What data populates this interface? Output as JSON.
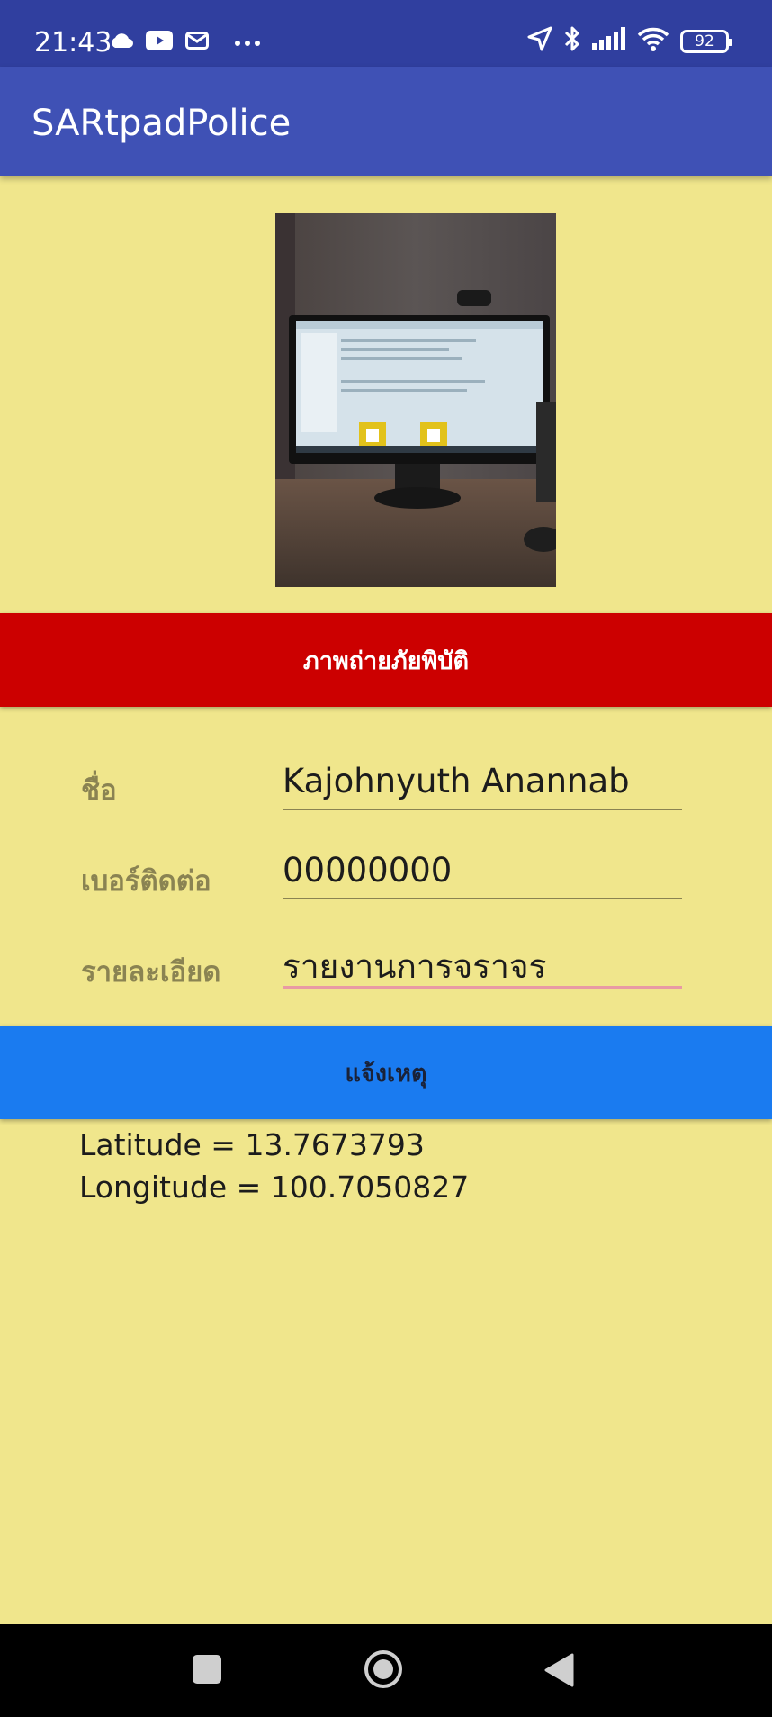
{
  "status_bar": {
    "time": "21:43",
    "left_icons": [
      "cloud-icon",
      "youtube-icon",
      "mail-icon",
      "more-dots-icon"
    ],
    "right_icons": [
      "location-arrow-icon",
      "bluetooth-icon",
      "signal-icon",
      "wifi-icon",
      "battery-icon"
    ],
    "battery_level": "92"
  },
  "app_bar": {
    "title": "SARtpadPolice"
  },
  "photo": {
    "description_icon": "captured-photo-image"
  },
  "buttons": {
    "take_photo": "ภาพถ่ายภัยพิบัติ",
    "report": "แจ้งเหตุ"
  },
  "form": {
    "name_label": "ชื่อ",
    "name_value": "Kajohnyuth Anannab",
    "phone_label": "เบอร์ติดต่อ",
    "phone_value": "00000000",
    "detail_label": "รายละเอียด",
    "detail_value": "รายงานการจราจร"
  },
  "location": {
    "latitude": "Latitude = 13.7673793",
    "longitude": "Longitude = 100.7050827"
  },
  "colors": {
    "background": "#f0e68c",
    "app_bar": "#3f51b5",
    "status_bar": "#303f9f",
    "photo_button": "#cc0000",
    "report_button": "#1a7bf0"
  }
}
